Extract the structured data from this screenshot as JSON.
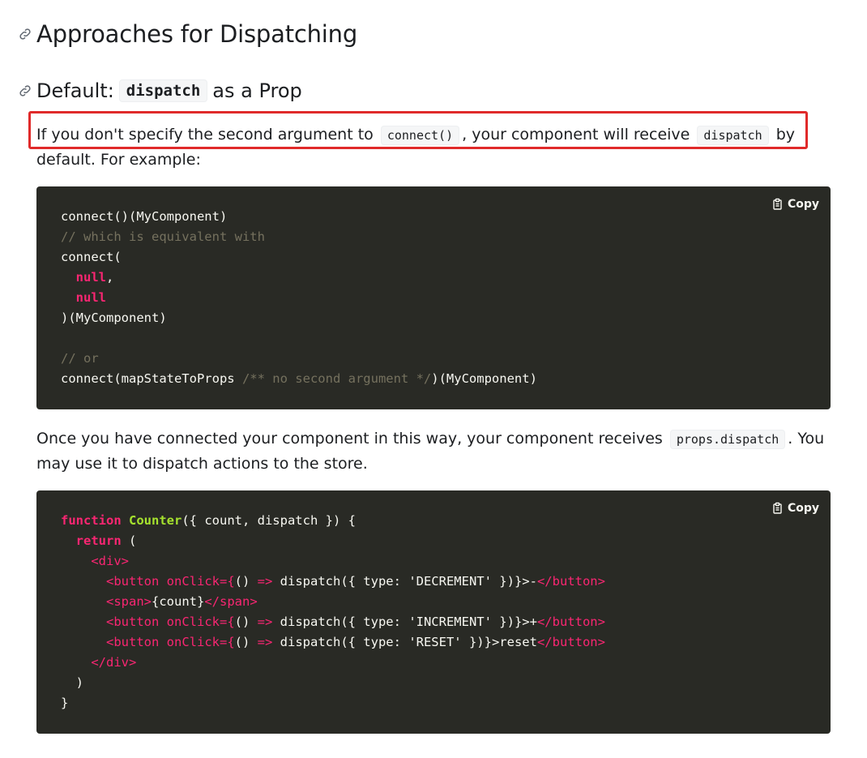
{
  "headings": {
    "h2": "Approaches for Dispatching",
    "h3_prefix": "Default:",
    "h3_code": "dispatch",
    "h3_suffix": "as a Prop"
  },
  "para1": {
    "t1": "If you don't specify the second argument to",
    "c1": "connect()",
    "t2": ", your component will receive",
    "c2": "dispatch",
    "t3": "by default. For example:"
  },
  "code1": {
    "copy_label": "Copy",
    "lines": [
      [
        {
          "t": "connect()(MyComponent)",
          "c": "plain"
        }
      ],
      [
        {
          "t": "// which is equivalent with",
          "c": "comment"
        }
      ],
      [
        {
          "t": "connect(",
          "c": "plain"
        }
      ],
      [
        {
          "t": "  ",
          "c": "plain"
        },
        {
          "t": "null",
          "c": "kw"
        },
        {
          "t": ",",
          "c": "plain"
        }
      ],
      [
        {
          "t": "  ",
          "c": "plain"
        },
        {
          "t": "null",
          "c": "kw"
        }
      ],
      [
        {
          "t": ")(MyComponent)",
          "c": "plain"
        }
      ],
      [],
      [
        {
          "t": "// or",
          "c": "comment"
        }
      ],
      [
        {
          "t": "connect(mapStateToProps ",
          "c": "plain"
        },
        {
          "t": "/** no second argument */",
          "c": "comment"
        },
        {
          "t": ")(MyComponent)",
          "c": "plain"
        }
      ]
    ]
  },
  "para2": {
    "t1": "Once you have connected your component in this way, your component receives",
    "c1": "props.dispatch",
    "t2": ". You may use it to dispatch actions to the store."
  },
  "code2": {
    "copy_label": "Copy",
    "lines": [
      [
        {
          "t": "function ",
          "c": "kw"
        },
        {
          "t": "Counter",
          "c": "fn"
        },
        {
          "t": "({ count, dispatch }) {",
          "c": "plain"
        }
      ],
      [
        {
          "t": "  ",
          "c": "plain"
        },
        {
          "t": "return",
          "c": "kw"
        },
        {
          "t": " (",
          "c": "plain"
        }
      ],
      [
        {
          "t": "    ",
          "c": "plain"
        },
        {
          "t": "<div>",
          "c": "tag"
        }
      ],
      [
        {
          "t": "      ",
          "c": "plain"
        },
        {
          "t": "<button ",
          "c": "tag"
        },
        {
          "t": "onClick",
          "c": "attr"
        },
        {
          "t": "={",
          "c": "punct"
        },
        {
          "t": "() ",
          "c": "plain"
        },
        {
          "t": "=>",
          "c": "punct"
        },
        {
          "t": " dispatch({ type: ",
          "c": "plain"
        },
        {
          "t": "'DECREMENT'",
          "c": "str"
        },
        {
          "t": " })}>-",
          "c": "plain"
        },
        {
          "t": "</button>",
          "c": "tag"
        }
      ],
      [
        {
          "t": "      ",
          "c": "plain"
        },
        {
          "t": "<span>",
          "c": "tag"
        },
        {
          "t": "{count}",
          "c": "plain"
        },
        {
          "t": "</span>",
          "c": "tag"
        }
      ],
      [
        {
          "t": "      ",
          "c": "plain"
        },
        {
          "t": "<button ",
          "c": "tag"
        },
        {
          "t": "onClick",
          "c": "attr"
        },
        {
          "t": "={",
          "c": "punct"
        },
        {
          "t": "() ",
          "c": "plain"
        },
        {
          "t": "=>",
          "c": "punct"
        },
        {
          "t": " dispatch({ type: ",
          "c": "plain"
        },
        {
          "t": "'INCREMENT'",
          "c": "str"
        },
        {
          "t": " })}>+",
          "c": "plain"
        },
        {
          "t": "</button>",
          "c": "tag"
        }
      ],
      [
        {
          "t": "      ",
          "c": "plain"
        },
        {
          "t": "<button ",
          "c": "tag"
        },
        {
          "t": "onClick",
          "c": "attr"
        },
        {
          "t": "={",
          "c": "punct"
        },
        {
          "t": "() ",
          "c": "plain"
        },
        {
          "t": "=>",
          "c": "punct"
        },
        {
          "t": " dispatch({ type: ",
          "c": "plain"
        },
        {
          "t": "'RESET'",
          "c": "str"
        },
        {
          "t": " })}>reset",
          "c": "plain"
        },
        {
          "t": "</button>",
          "c": "tag"
        }
      ],
      [
        {
          "t": "    ",
          "c": "plain"
        },
        {
          "t": "</div>",
          "c": "tag"
        }
      ],
      [
        {
          "t": "  )",
          "c": "plain"
        }
      ],
      [
        {
          "t": "}",
          "c": "plain"
        }
      ]
    ]
  },
  "colors": {
    "highlight_border": "#e02a2a",
    "code_bg": "#292a25",
    "keyword": "#f92672",
    "function": "#a6e22e",
    "comment": "#75715e"
  },
  "icons": {
    "anchor": "link-icon",
    "copy": "clipboard-icon"
  }
}
